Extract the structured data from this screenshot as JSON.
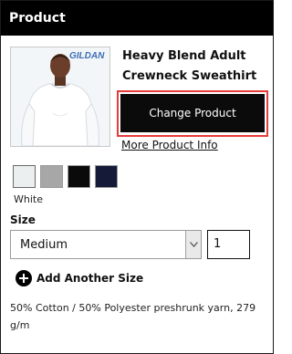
{
  "header": {
    "title": "Product"
  },
  "product": {
    "brand_logo": "GILDAN",
    "title": "Heavy Blend Adult Crewneck Sweathirt",
    "change_label": "Change Product",
    "more_info_label": "More Product Info",
    "description": "50% Cotton / 50% Polyester preshrunk yarn, 279 g/m"
  },
  "colors": {
    "selected_name": "White",
    "swatches": [
      {
        "name": "White",
        "hex": "#eceff0"
      },
      {
        "name": "Grey",
        "hex": "#a7a7a7"
      },
      {
        "name": "Black",
        "hex": "#0a0a0a"
      },
      {
        "name": "Navy",
        "hex": "#141a38"
      }
    ]
  },
  "size": {
    "label": "Size",
    "selected": "Medium",
    "quantity": "1"
  },
  "add_size_label": "Add Another Size",
  "accent": {
    "highlight": "#e53b3b",
    "primary": "#0b0b0b"
  }
}
